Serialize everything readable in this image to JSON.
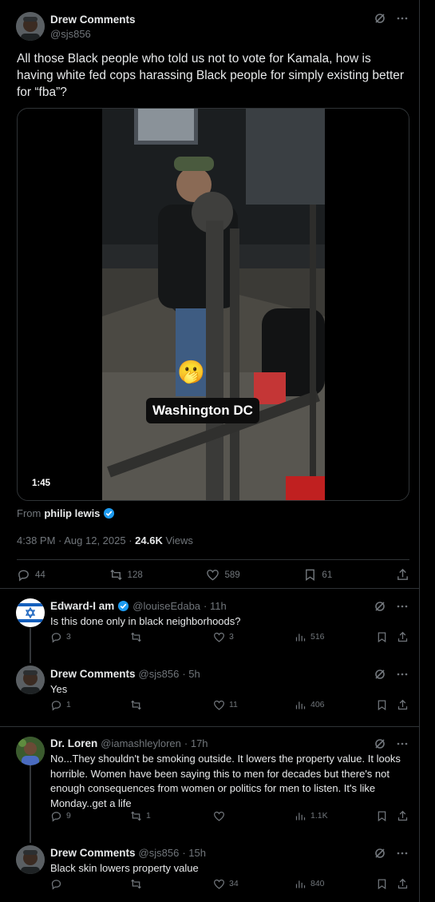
{
  "main_tweet": {
    "author_name": "Drew Comments",
    "author_handle": "@sjs856",
    "text": "All those Black people who told us not to vote for Kamala, how is having white fed cops harassing Black people for simply existing better for “fba”?",
    "video": {
      "caption": "Washington DC",
      "emoji": "🫢",
      "duration": "1:45"
    },
    "from_label": "From",
    "from_source": "philip lewis",
    "timestamp": "4:38 PM · Aug 12, 2025 · ",
    "views_count": "24.6K",
    "views_label": " Views",
    "actions": {
      "replies": "44",
      "reposts": "128",
      "likes": "589",
      "bookmarks": "61"
    }
  },
  "replies": [
    {
      "name": "Edward-I am",
      "verified": true,
      "handle": "@louiseEdaba",
      "time": "· 11h",
      "text": "Is this done only in black neighborhoods?",
      "replies": "3",
      "reposts": "",
      "likes": "3",
      "views": "516"
    },
    {
      "name": "Drew Comments",
      "verified": false,
      "handle": "@sjs856",
      "time": "· 5h",
      "text": "Yes",
      "replies": "1",
      "reposts": "",
      "likes": "11",
      "views": "406"
    },
    {
      "name": "Dr. Loren",
      "verified": false,
      "handle": "@iamashleyloren",
      "time": "· 17h",
      "text": "No...They shouldn't be smoking outside. It lowers the property value. It looks horrible. Women have been saying this to men for decades but there's not enough consequences from women or politics for men to listen. It's like Monday..get a life",
      "replies": "9",
      "reposts": "1",
      "likes": "",
      "views": "1.1K"
    },
    {
      "name": "Drew Comments",
      "verified": false,
      "handle": "@sjs856",
      "time": "· 15h",
      "text": "Black skin lowers property value",
      "replies": "",
      "reposts": "",
      "likes": "34",
      "views": "840"
    }
  ],
  "colors": {
    "background": "#000000",
    "text": "#e7e9ea",
    "muted": "#71767b",
    "border": "#2f3336",
    "verified_blue": "#1d9bf0"
  }
}
